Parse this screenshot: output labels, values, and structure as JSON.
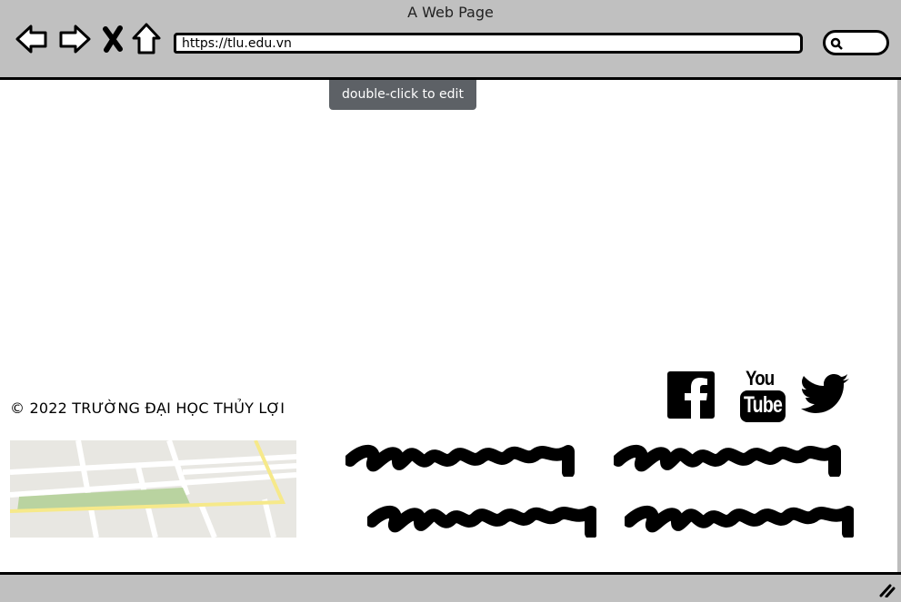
{
  "window": {
    "title": "A Web Page"
  },
  "toolbar": {
    "back_icon": "back-arrow-icon",
    "forward_icon": "forward-arrow-icon",
    "stop_icon": "close-icon",
    "home_icon": "home-icon",
    "url": "https://tlu.edu.vn",
    "search_icon": "search-icon"
  },
  "tooltip": {
    "text": "double-click to edit"
  },
  "footer": {
    "copyright": "© 2022 TRƯỜNG ĐẠI HỌC THỦY LỢI",
    "social": [
      "facebook-icon",
      "youtube-icon",
      "twitter-icon"
    ],
    "youtube_you": "You",
    "youtube_tube": "Tube"
  },
  "colors": {
    "chrome": "#c0c0c0",
    "tooltip_bg": "#5d6166",
    "map_bg": "#e8e7e2",
    "map_park": "#b9d3a0",
    "map_road_yellow": "#f6e98a"
  }
}
